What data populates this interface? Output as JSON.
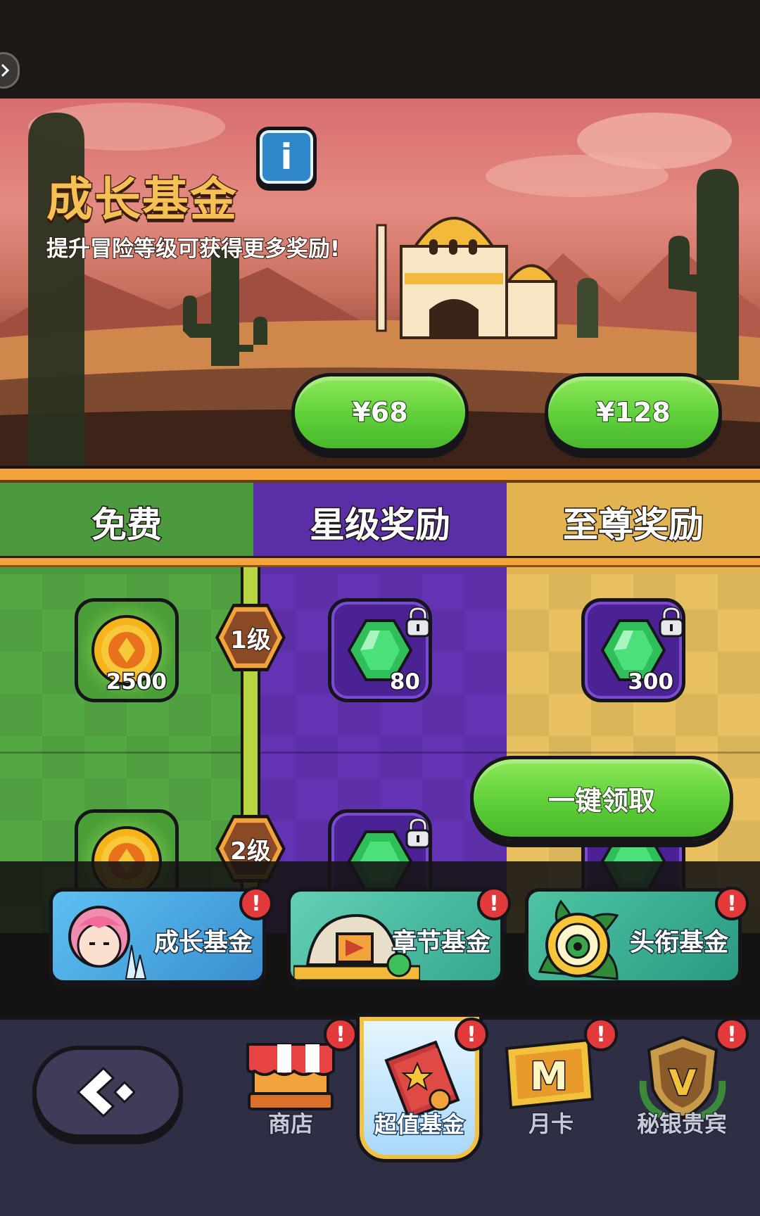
{
  "banner": {
    "title": "成长基金",
    "subtitle": "提升冒险等级可获得更多奖励!",
    "info_icon": "i",
    "price_buttons": [
      "¥68",
      "¥128"
    ]
  },
  "columns": {
    "free": "免费",
    "star": "星级奖励",
    "supreme": "至尊奖励"
  },
  "levels": [
    {
      "label": "1级",
      "free_reward": {
        "icon": "gold-coin-icon",
        "amount": "2500"
      },
      "star_reward": {
        "icon": "green-gem-icon",
        "amount": "80",
        "locked": true
      },
      "supreme_reward": {
        "icon": "green-gem-icon",
        "amount": "300",
        "locked": true
      }
    },
    {
      "label": "2级",
      "free_reward": {
        "icon": "gold-coin-icon"
      },
      "star_reward": {
        "icon": "green-gem-icon",
        "locked": true
      },
      "supreme_reward": {
        "icon": "green-gem-icon",
        "locked": true
      }
    }
  ],
  "claim_all": "一键领取",
  "fund_tabs": [
    {
      "label": "成长基金",
      "alert": "!",
      "color": "#4aa8e0"
    },
    {
      "label": "章节基金",
      "alert": "!",
      "color": "#3fb8a0"
    },
    {
      "label": "头衔基金",
      "alert": "!",
      "color": "#2fa890"
    }
  ],
  "bottom_nav": {
    "items": [
      {
        "label": "商店",
        "icon": "shop-icon",
        "alert": "!"
      },
      {
        "label": "超值基金",
        "icon": "fund-card-icon",
        "alert": "!",
        "active": true
      },
      {
        "label": "月卡",
        "icon": "monthly-card-icon",
        "alert": "!"
      },
      {
        "label": "秘银贵宾",
        "icon": "vip-shield-icon",
        "alert": "!"
      }
    ]
  },
  "colors": {
    "free_column": "#54a844",
    "star_column": "#6333b4",
    "supreme_column": "#e9c060",
    "accent_orange": "#f3a33c",
    "button_green": "#5fcf3a"
  }
}
